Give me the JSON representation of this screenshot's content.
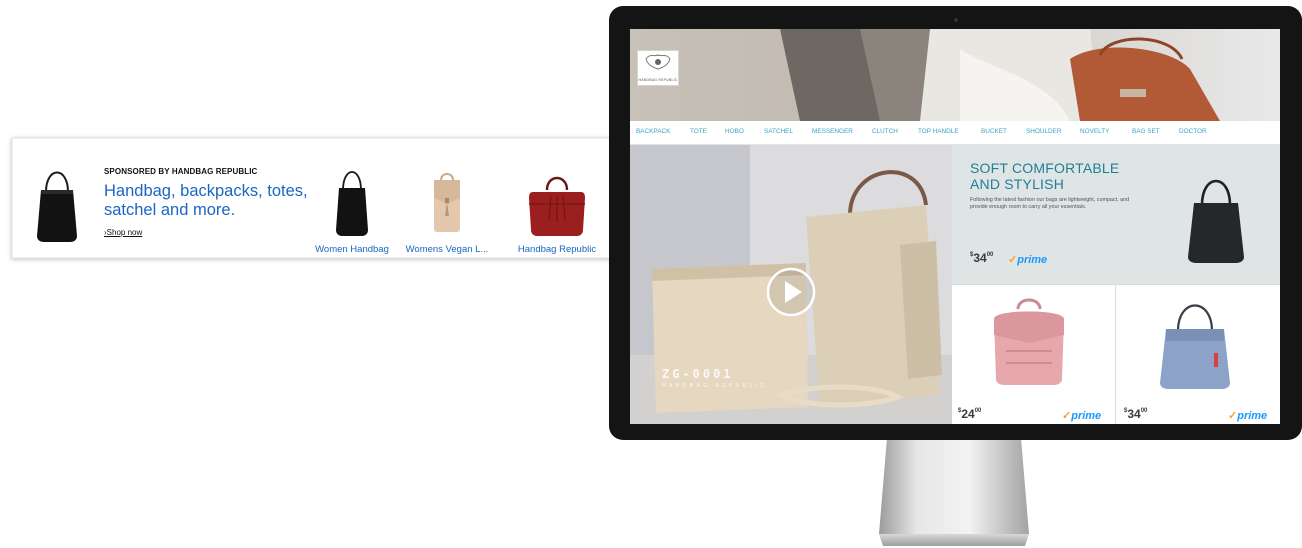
{
  "ad": {
    "sponsor": "SPONSORED BY HANDBAG REPUBLIC",
    "headline": "Handbag, backpacks, totes, satchel and more.",
    "shop_link": "›Shop now",
    "products": [
      {
        "label": "Women Handbag",
        "icon": "black-hobo-bag-icon"
      },
      {
        "label": "Womens Vegan L...",
        "icon": "beige-backpack-icon"
      },
      {
        "label": "Handbag Republic",
        "icon": "red-satchel-icon"
      }
    ]
  },
  "store": {
    "logo_text": "HANDBAG REPUBLIC",
    "nav": [
      "BACKPACK",
      "TOTE",
      "HOBO",
      "SATCHEL",
      "MESSENGER",
      "CLUTCH",
      "TOP HANDLE",
      "BUCKET",
      "SHOULDER",
      "NOVELTY",
      "BAG SET",
      "DOCTOR"
    ],
    "video": {
      "code": "ZG-0001",
      "brand": "HANDBAG REPUBLIC"
    },
    "promo": {
      "title": "SOFT COMFORTABLE AND STYLISH",
      "description": "Following the latest fashion our bags are lightweight, compact, and provide enough room to carry all your essentials.",
      "price_main": "34",
      "price_cents": "00",
      "prime": "prime"
    },
    "tiles": [
      {
        "price_main": "24",
        "price_cents": "00",
        "prime": "prime",
        "icon": "pink-backpack-icon"
      },
      {
        "price_main": "34",
        "price_cents": "00",
        "prime": "prime",
        "icon": "blue-bucket-bag-icon"
      }
    ]
  },
  "colors": {
    "link_blue": "#1a66c2",
    "nav_teal": "#3aa3c1",
    "promo_title": "#1f7f96",
    "prime_blue": "#1a98ff"
  }
}
